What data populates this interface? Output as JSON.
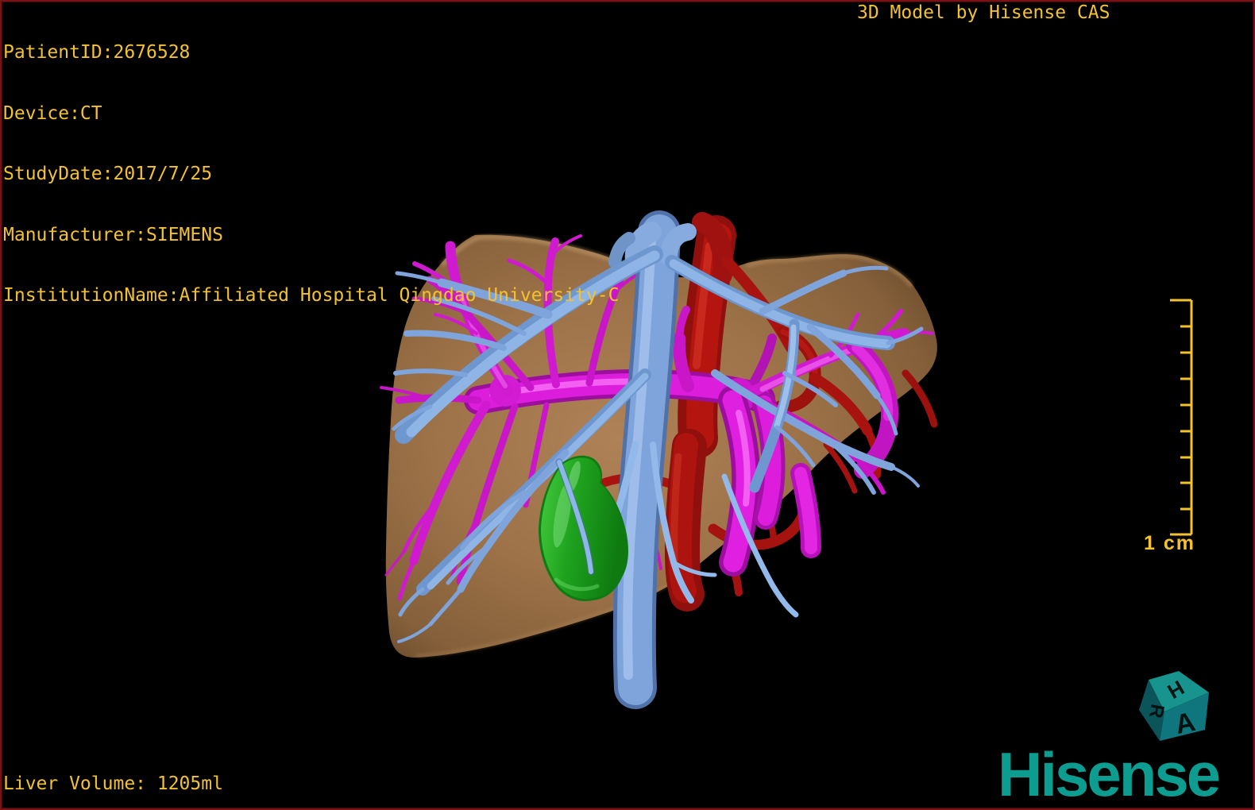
{
  "overlay": {
    "patient": {
      "patient_id": "PatientID:2676528",
      "device": "Device:CT",
      "study_date": "StudyDate:2017/7/25",
      "manufacturer": "Manufacturer:SIEMENS",
      "institution": "InstitutionName:Affiliated Hospital Qingdao University-C"
    },
    "watermark": "3D Model by Hisense CAS",
    "liver_volume": "Liver Volume: 1205ml"
  },
  "scale_bar": {
    "label": "1 cm"
  },
  "orientation_cube": {
    "top_face": "H",
    "left_face": "R",
    "right_face": "A"
  },
  "branding": {
    "logo": "Hisense",
    "logo_color": "#0D9C90"
  },
  "model": {
    "structures": [
      {
        "name": "liver",
        "color": "#A0764C"
      },
      {
        "name": "hepatic-veins-ivc",
        "color": "#7FA4DC"
      },
      {
        "name": "portal-vein",
        "color": "#DC1EDC"
      },
      {
        "name": "hepatic-artery-aorta",
        "color": "#B01510"
      },
      {
        "name": "gallbladder",
        "color": "#1FA31F"
      }
    ]
  },
  "colors": {
    "text_accent": "#F3C22E",
    "background": "#000000",
    "frame_border": "#7A1215"
  }
}
